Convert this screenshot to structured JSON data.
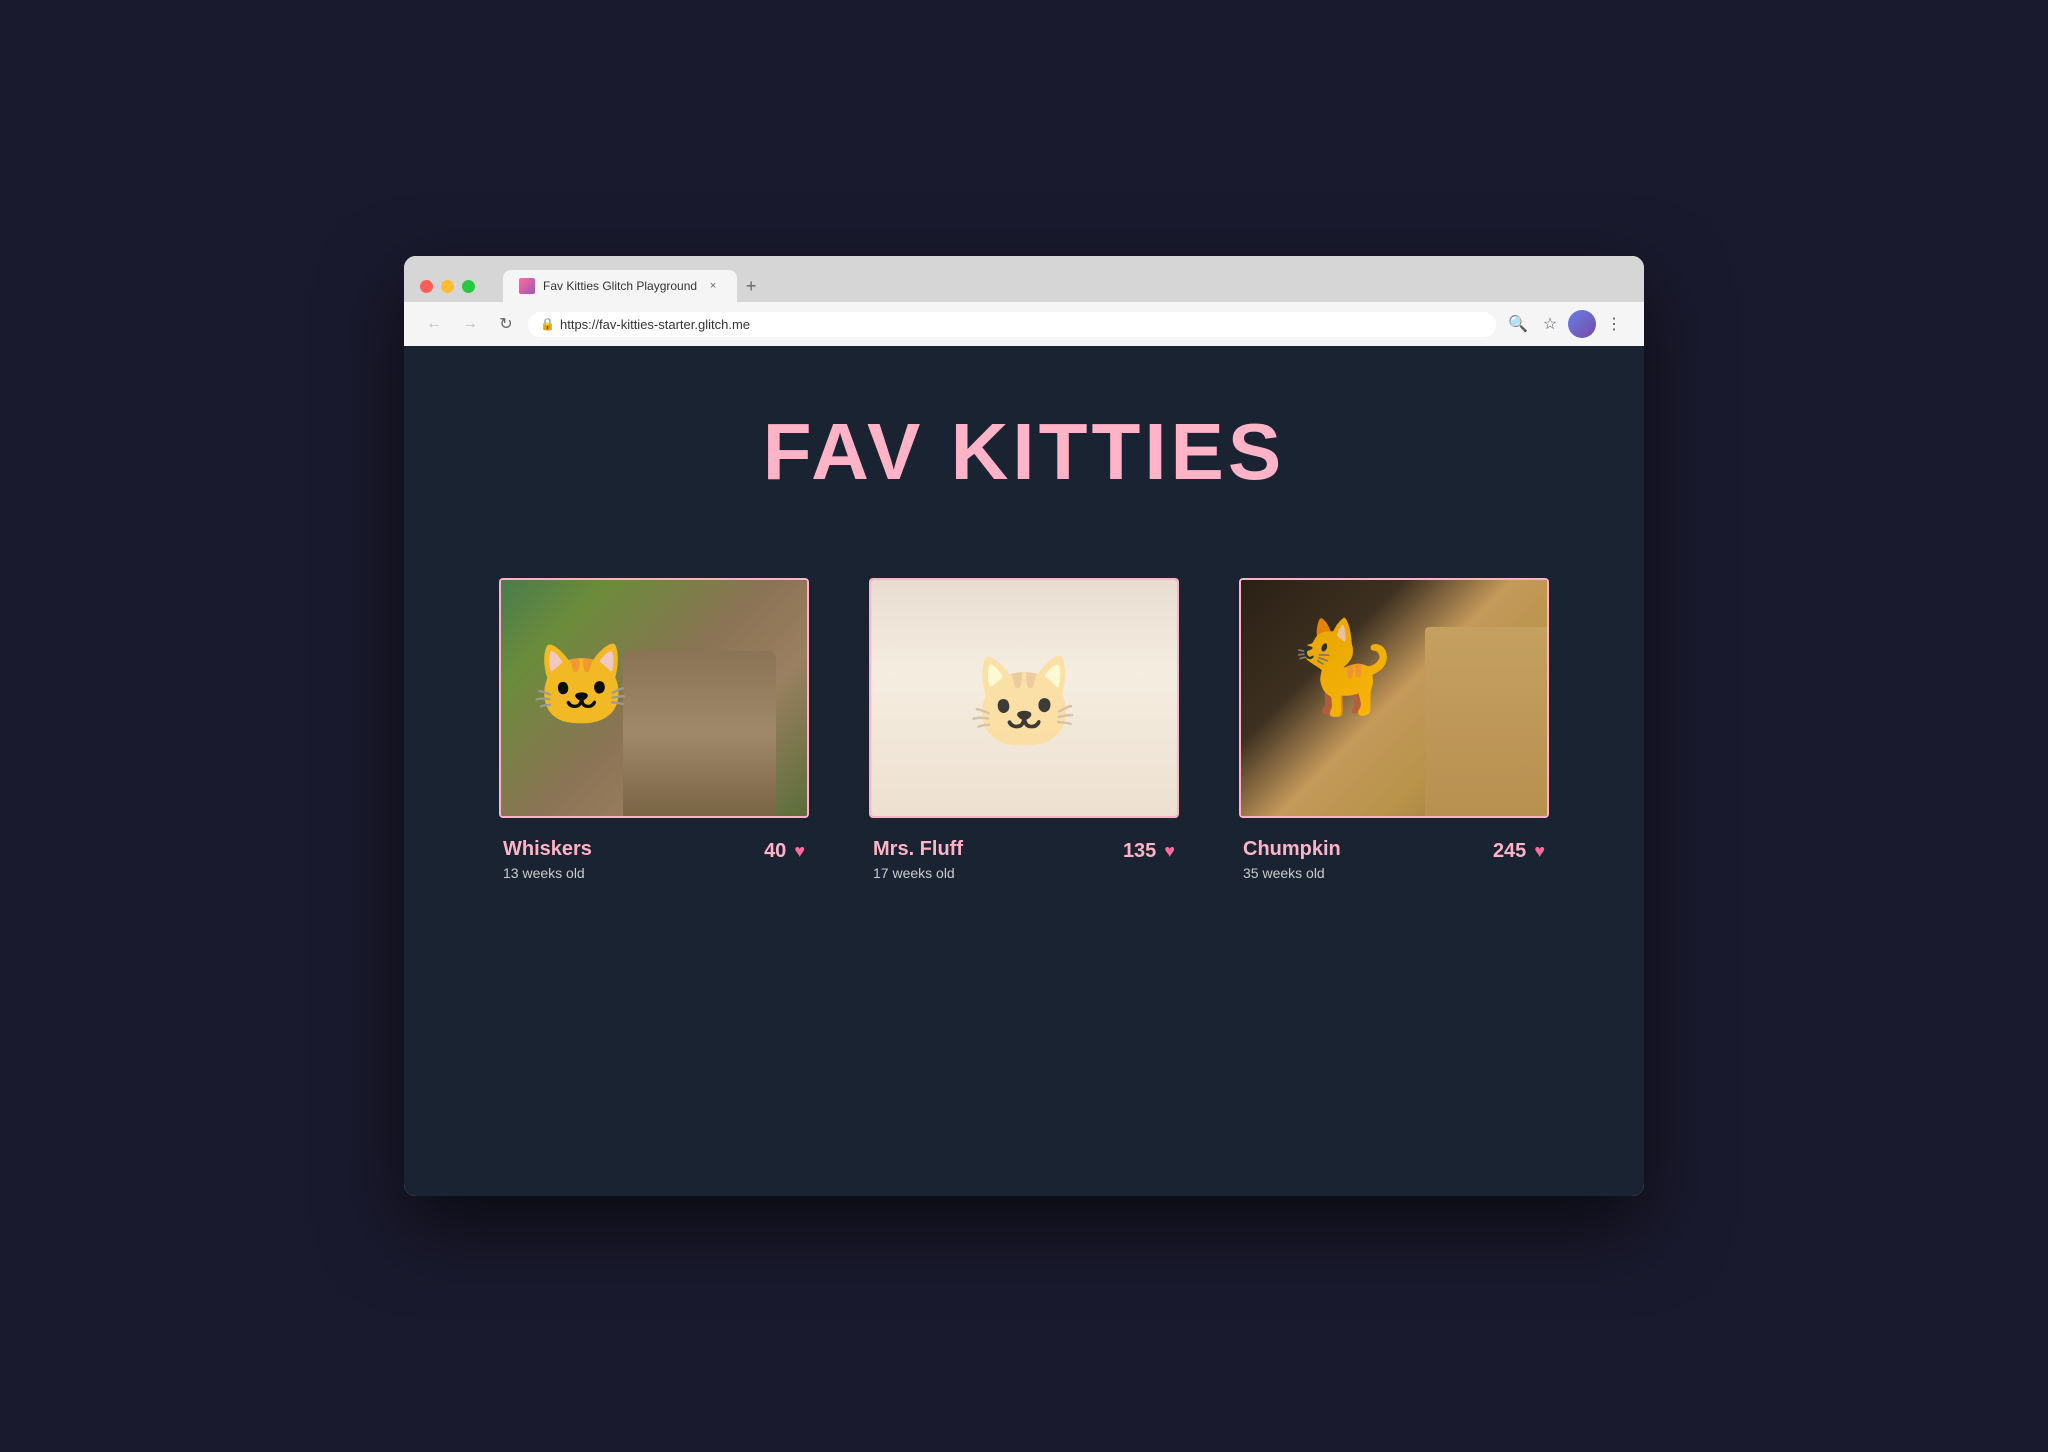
{
  "browser": {
    "tab_title": "Fav Kitties Glitch Playground",
    "tab_new_label": "+",
    "tab_close_label": "×",
    "address": "https://fav-kitties-starter.glitch.me",
    "nav": {
      "back_label": "←",
      "forward_label": "→",
      "reload_label": "↻"
    },
    "toolbar": {
      "search_label": "🔍",
      "bookmark_label": "☆",
      "menu_label": "⋮"
    }
  },
  "site": {
    "title": "FAV KITTIES",
    "kitties": [
      {
        "id": "whiskers",
        "name": "Whiskers",
        "age": "13 weeks old",
        "votes": "40",
        "image_style": "kitty-whiskers"
      },
      {
        "id": "mrs-fluff",
        "name": "Mrs. Fluff",
        "age": "17 weeks old",
        "votes": "135",
        "image_style": "kitty-mrs-fluff"
      },
      {
        "id": "chumpkin",
        "name": "Chumpkin",
        "age": "35 weeks old",
        "votes": "245",
        "image_style": "kitty-chumpkin"
      }
    ]
  }
}
